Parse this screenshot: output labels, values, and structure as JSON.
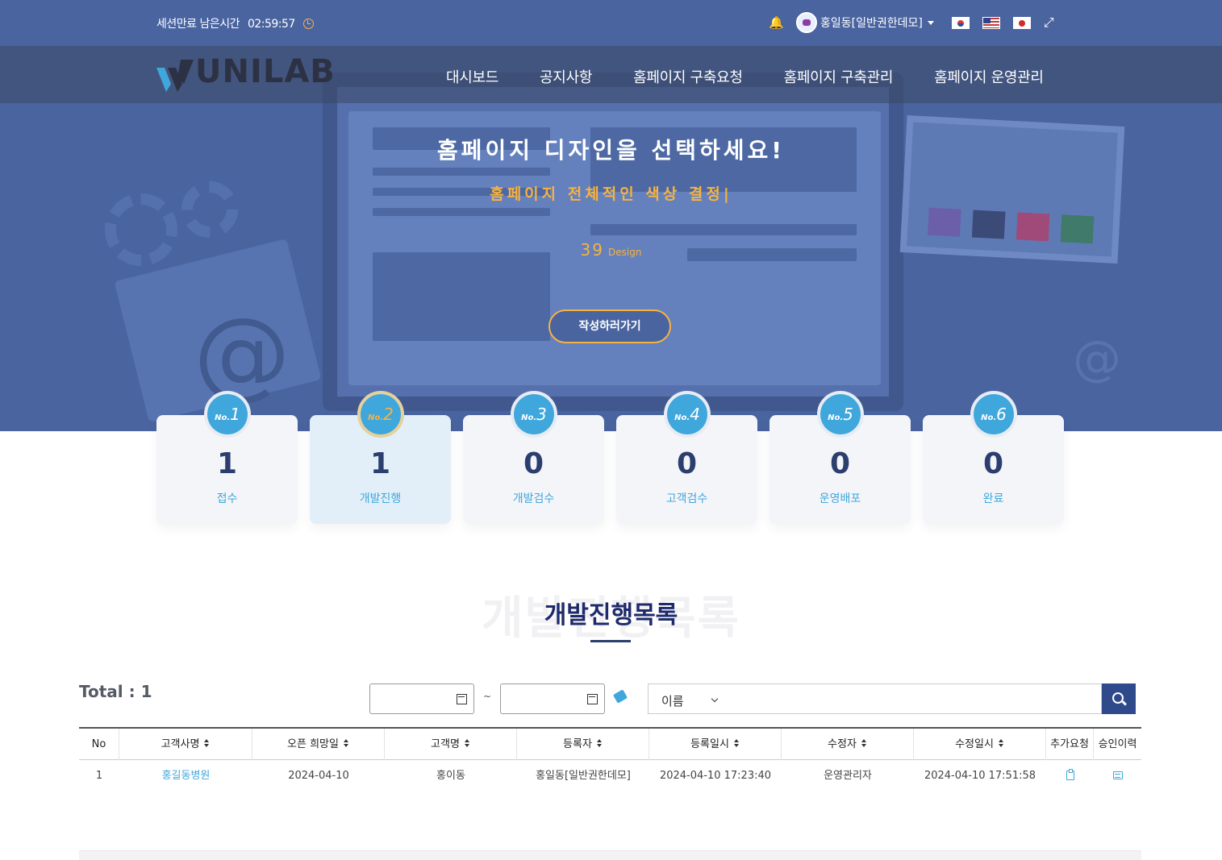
{
  "topbar": {
    "session_label": "세션만료 남은시간",
    "session_time": "02:59:57",
    "user_name": "홍일동[일반권한데모]",
    "icons": [
      "bell-icon",
      "user-avatar",
      "flag-kr-icon",
      "flag-us-icon",
      "flag-jp-icon",
      "fullscreen-icon",
      "clock-icon"
    ]
  },
  "logo": {
    "text": "UNILAB"
  },
  "nav": {
    "items": [
      {
        "label": "대시보드"
      },
      {
        "label": "공지사항"
      },
      {
        "label": "홈페이지 구축요청"
      },
      {
        "label": "홈페이지 구축관리"
      },
      {
        "label": "홈페이지 운영관리"
      }
    ]
  },
  "hero": {
    "title": "홈페이지 디자인을 선택하세요!",
    "subtitle": "홈페이지 전체적인 색상 결정|",
    "count": "39",
    "count_unit": "Design",
    "button": "작성하러가기"
  },
  "status_cards": [
    {
      "no": "1",
      "value": "1",
      "label": "접수"
    },
    {
      "no": "2",
      "value": "1",
      "label": "개발진행"
    },
    {
      "no": "3",
      "value": "0",
      "label": "개발검수"
    },
    {
      "no": "4",
      "value": "0",
      "label": "고객검수"
    },
    {
      "no": "5",
      "value": "0",
      "label": "운영배포"
    },
    {
      "no": "6",
      "value": "0",
      "label": "완료"
    }
  ],
  "badge_prefix": "No.",
  "active_card_index": 1,
  "section": {
    "title": "개발진행목록",
    "bg_title": "개발진행목록"
  },
  "filter": {
    "total_label": "Total : 1",
    "date_from": "",
    "date_to": "",
    "tilde": "~",
    "search_type": "이름",
    "search_value": ""
  },
  "table": {
    "headers": [
      "No",
      "고객사명",
      "오픈 희망일",
      "고객명",
      "등록자",
      "등록일시",
      "수정자",
      "수정일시",
      "추가요청",
      "승인이력"
    ],
    "rows": [
      [
        "1",
        "홍길동병원",
        "2024-04-10",
        "홍이동",
        "홍일동[일반권한데모]",
        "2024-04-10 17:23:40",
        "운영관리자",
        "2024-04-10 17:51:58",
        "",
        ""
      ]
    ]
  },
  "colors": {
    "hero_bg": "#4a64a0",
    "accent": "#f5b342",
    "link": "#3fa7dc",
    "title_navy": "#1e2a6b",
    "search_button": "#2e4a8a"
  }
}
